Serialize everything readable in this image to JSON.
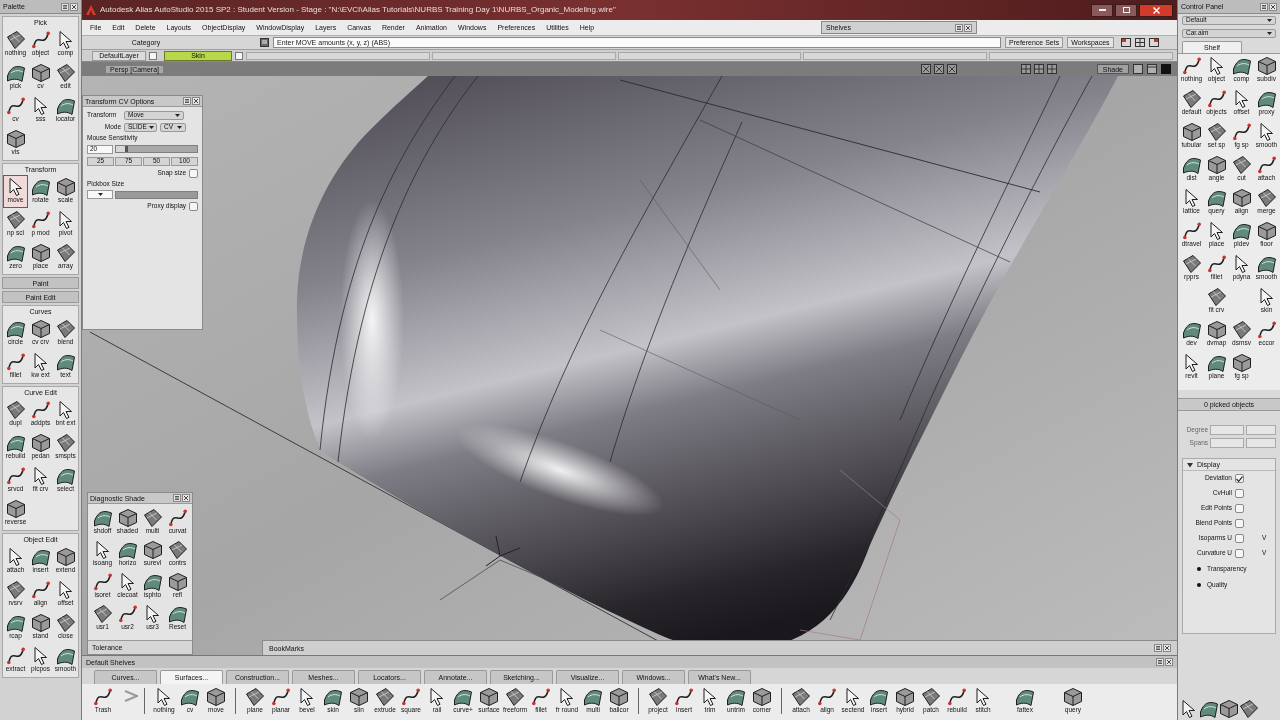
{
  "title_bar": {
    "title": "Autodesk Alias AutoStudio 2015 SP2 : Student Version - Stage : \"N:\\EVCI\\Alias Tutorials\\NURBS Training Day 1\\NURBS_Organic_Modeling.wire\""
  },
  "menu_bar": {
    "items": [
      "File",
      "Edit",
      "Delete",
      "Layouts",
      "ObjectDisplay",
      "WindowDisplay",
      "Layers",
      "Canvas",
      "Render",
      "Animation",
      "Windows",
      "Preferences",
      "Utilities",
      "Help"
    ],
    "shelves_window": "Shelves"
  },
  "prompt_bar": {
    "category": "Category",
    "prompt": "Enter MOVE amounts (x, y, z) (ABS)",
    "buttons": [
      "Preference Sets",
      "Workspaces"
    ]
  },
  "layer_bar": {
    "default_layer": "DefaultLayer",
    "layers": [
      {
        "name": "Skin",
        "selected": true
      }
    ]
  },
  "viewport": {
    "label": "Persp [Camera]",
    "shade_button": "Shade"
  },
  "palette": {
    "title": "Palette",
    "sections": [
      {
        "title": "Pick",
        "expanded": true,
        "tools": [
          {
            "label": "nothing",
            "selected": false
          },
          {
            "label": "object",
            "selected": false
          },
          {
            "label": "comp",
            "selected": false
          },
          {
            "label": "pick",
            "selected": false
          },
          {
            "label": "cv",
            "selected": false
          },
          {
            "label": "edit",
            "selected": false
          },
          {
            "label": "cv",
            "selected": false
          },
          {
            "label": "sss",
            "selected": false
          },
          {
            "label": "locator",
            "selected": false
          },
          {
            "label": "vis",
            "selected": false
          }
        ]
      },
      {
        "title": "Transform",
        "expanded": true,
        "tools": [
          {
            "label": "move",
            "selected": true
          },
          {
            "label": "rotate",
            "selected": false
          },
          {
            "label": "scale",
            "selected": false
          },
          {
            "label": "np scl",
            "selected": false
          },
          {
            "label": "p mod",
            "selected": false
          },
          {
            "label": "pivot",
            "selected": false
          },
          {
            "label": "zero",
            "selected": false
          },
          {
            "label": "place",
            "selected": false
          },
          {
            "label": "array",
            "selected": false
          }
        ]
      },
      {
        "title": "Paint",
        "expanded": false
      },
      {
        "title": "Paint Edit",
        "expanded": false
      },
      {
        "title": "Curves",
        "expanded": true,
        "tools": [
          {
            "label": "circle",
            "selected": false
          },
          {
            "label": "cv crv",
            "selected": false
          },
          {
            "label": "blend",
            "selected": false
          },
          {
            "label": "fillet",
            "selected": false
          },
          {
            "label": "kw ext",
            "selected": false
          },
          {
            "label": "text",
            "selected": false
          }
        ]
      },
      {
        "title": "Curve Edit",
        "expanded": true,
        "tools": [
          {
            "label": "dupl",
            "selected": false
          },
          {
            "label": "addpts",
            "selected": false
          },
          {
            "label": "bnt ext",
            "selected": false
          },
          {
            "label": "rebuild",
            "selected": false
          },
          {
            "label": "pedan",
            "selected": false
          },
          {
            "label": "smspts",
            "selected": false
          },
          {
            "label": "srvcd",
            "selected": false
          },
          {
            "label": "fit crv",
            "selected": false
          },
          {
            "label": "select",
            "selected": false
          },
          {
            "label": "reverse",
            "selected": false
          }
        ]
      },
      {
        "title": "Object Edit",
        "expanded": true,
        "tools": [
          {
            "label": "attach",
            "selected": false
          },
          {
            "label": "insert",
            "selected": false
          },
          {
            "label": "extend",
            "selected": false
          },
          {
            "label": "rvsrv",
            "selected": false
          },
          {
            "label": "align",
            "selected": false
          },
          {
            "label": "offset",
            "selected": false
          },
          {
            "label": "rcap",
            "selected": false
          },
          {
            "label": "stand",
            "selected": false
          },
          {
            "label": "close",
            "selected": false
          },
          {
            "label": "extract",
            "selected": false
          },
          {
            "label": "plcpos",
            "selected": false
          },
          {
            "label": "smooth",
            "selected": false
          }
        ]
      }
    ]
  },
  "transform_cv_options": {
    "title": "Transform CV Options",
    "transform_label": "Transform",
    "transform_value": "Move",
    "mode_label": "Mode",
    "mode_value": "SLIDE",
    "mode_target": "CV",
    "sensitivity_label": "Mouse Sensitivity",
    "sensitivity": {
      "value": "20",
      "level": 0.15
    },
    "presets": [
      "25",
      "75",
      "50",
      "100"
    ],
    "snap_size": {
      "label": "Snap size",
      "checked": false
    },
    "pickbox_label": "Pickbox Size",
    "proxy_display": {
      "label": "Proxy display",
      "checked": false
    }
  },
  "diagnostic_shade": {
    "title": "Diagnostic Shade",
    "tools": [
      "shdoff",
      "shaded",
      "multi",
      "curvat",
      "isoang",
      "horizo",
      "surevl",
      "contrs",
      "isoret",
      "clecoat",
      "isphto",
      "refl",
      "usr1",
      "usr2",
      "usr3",
      "Reset"
    ],
    "tolerance": "Tolerance"
  },
  "bookmarks": {
    "label": "BookMarks"
  },
  "shelves": {
    "title": "Default Shelves",
    "tabs": [
      {
        "label": "Curves...",
        "selected": false
      },
      {
        "label": "Surfaces...",
        "selected": true
      },
      {
        "label": "Construction...",
        "selected": false
      },
      {
        "label": "Meshes...",
        "selected": false
      },
      {
        "label": "Locators...",
        "selected": false
      },
      {
        "label": "Annotate...",
        "selected": false
      },
      {
        "label": "Sketching...",
        "selected": false
      },
      {
        "label": "Visualize...",
        "selected": false
      },
      {
        "label": "Windows...",
        "selected": false
      },
      {
        "label": "What's New...",
        "selected": false
      }
    ],
    "tool_groups": [
      [
        "Trash"
      ],
      [
        "nothing",
        "cv",
        "move"
      ],
      [
        "plane",
        "planar",
        "bevel",
        "skin",
        "slin",
        "extrude",
        "square",
        "rail",
        "curve+",
        "surface",
        "freeform",
        "fillet",
        "fr round",
        "multi",
        "ballcor"
      ],
      [
        "project",
        "insert",
        "trim",
        "untrim",
        "corner"
      ],
      [
        "attach",
        "align",
        "sectend",
        "insert",
        "hybrid",
        "patch",
        "rebuild",
        "stitch"
      ],
      [
        "fattex",
        "query"
      ]
    ]
  },
  "control_panel": {
    "title": "Control Panel",
    "presets": [
      "Default",
      "Car.aim"
    ],
    "tabs": [
      {
        "label": "Shelf",
        "selected": true
      }
    ],
    "shelf_rows": [
      [
        "nothing",
        "object",
        "comp",
        "subdiv"
      ],
      [
        "default",
        "objects",
        "offset",
        "proxy"
      ],
      [
        "tubular",
        "set sp",
        "fg sp",
        "smooth"
      ],
      [
        "dist",
        "angle",
        "cut",
        "attach"
      ],
      [
        "lattice",
        "query",
        "align",
        "merge"
      ],
      [
        "dtravel",
        "place",
        "pldev",
        "floor"
      ],
      [
        "rpprs",
        "fillet",
        "pdyna",
        "smooth"
      ],
      [
        null,
        "fit crv",
        null,
        "skin"
      ],
      [
        "dev",
        "dvmap",
        "dsmsv",
        "eccor"
      ],
      [
        "revlt",
        "plane",
        "fg sp"
      ]
    ],
    "picked": "0 picked objects",
    "fields": [
      "Degree",
      "Spans"
    ],
    "display": {
      "title": "Display",
      "expanded": true,
      "options": [
        {
          "kind": "checkbox",
          "label": "Deviation",
          "checked": true
        },
        {
          "kind": "checkbox",
          "label": "CvHull",
          "checked": false
        },
        {
          "kind": "checkbox",
          "label": "Edit Points",
          "checked": false
        },
        {
          "kind": "checkbox",
          "label": "Blend Points",
          "checked": false
        },
        {
          "kind": "checkbox",
          "label": "Isoparms U",
          "checked": false,
          "suffix": "V"
        },
        {
          "kind": "checkbox",
          "label": "Curvature U",
          "checked": false,
          "suffix": "V"
        },
        {
          "kind": "bullet",
          "label": "Transparency"
        },
        {
          "kind": "bullet",
          "label": "Quality"
        }
      ]
    }
  }
}
